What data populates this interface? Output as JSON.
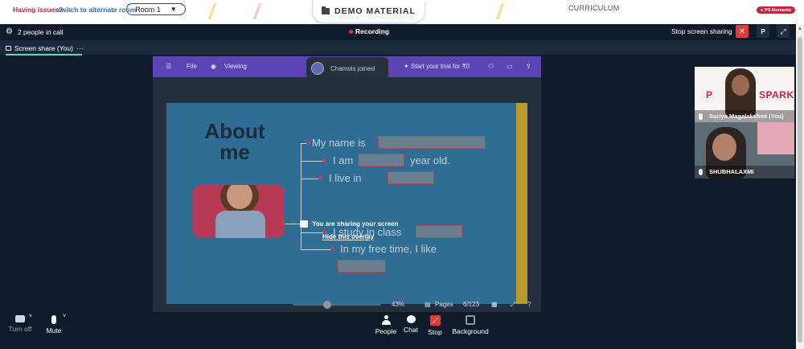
{
  "topbar": {
    "issues_text": "Having issues?",
    "switch_link": "switch to alternate room",
    "room_selected": "Room 1",
    "demo_tab": "DEMO MATERIAL",
    "curriculum": "CURRICULUM",
    "ps_moments": "PS Moments"
  },
  "call": {
    "people_count": "2 people in call",
    "recording": "Recording",
    "stop_sharing": "Stop screen sharing",
    "p_button": "P",
    "share_tab": "Screen share (You)",
    "share_tab_more": "···"
  },
  "shared_screen": {
    "toolbar": {
      "file": "File",
      "viewing": "Viewing",
      "trial": "Start your trial for ₹0"
    },
    "toast": "Chamois joined",
    "slide": {
      "title_line1": "About",
      "title_line2": "me",
      "lines": [
        "My name is",
        "I am",
        "year old.",
        "I live in",
        "I study in class",
        "In my free time, I like"
      ]
    },
    "overlay_message": "You are sharing your screen",
    "hide_overlay": "Hide this overlay",
    "zoom": "43%",
    "pages_label": "Pages",
    "page_count": "6/123",
    "help": "?"
  },
  "participants": [
    {
      "name": "Suriya Magalakshmi (You)",
      "brand_left": "P",
      "brand_right": "SPARK"
    },
    {
      "name": "SHUBHALAXMI"
    }
  ],
  "controls": {
    "camera": "Turn off",
    "mic": "Mute",
    "people": "People",
    "chat": "Chat",
    "stop": "Stop",
    "background": "Background"
  },
  "colors": {
    "call_bg": "#0f1b2a",
    "accent_red": "#e53935",
    "canva_purple": "#5d44b5",
    "slide_blue": "#2f6d94",
    "tab_underline": "#6ad4c4"
  }
}
